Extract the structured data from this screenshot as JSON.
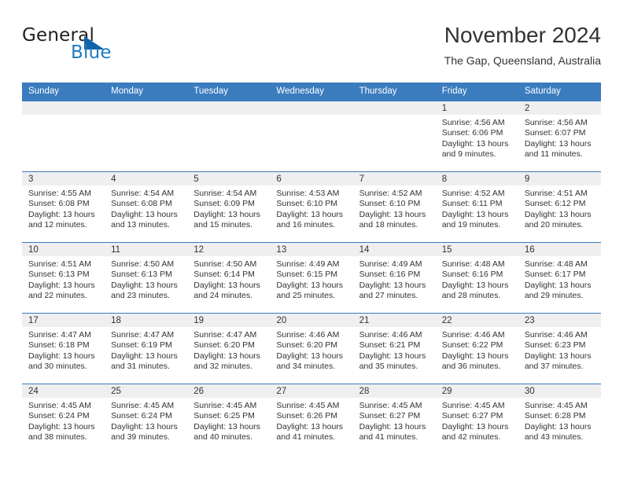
{
  "brand": {
    "name_part1": "General",
    "name_part2": "Blue",
    "accent_color": "#1f7bc1",
    "triangle_color": "#1064a8",
    "triangle_icon": "triangle-icon"
  },
  "header": {
    "title": "November 2024",
    "subtitle": "The Gap, Queensland, Australia"
  },
  "theme": {
    "header_row_bg": "#3a7cbe",
    "date_band_bg": "#efefef",
    "text_color": "#333333",
    "cell_border": "#3a7cbe"
  },
  "calendar": {
    "weekdays": [
      "Sunday",
      "Monday",
      "Tuesday",
      "Wednesday",
      "Thursday",
      "Friday",
      "Saturday"
    ],
    "labels": {
      "sunrise": "Sunrise:",
      "sunset": "Sunset:",
      "daylight": "Daylight:"
    },
    "weeks": [
      [
        {
          "date": "",
          "empty": true
        },
        {
          "date": "",
          "empty": true
        },
        {
          "date": "",
          "empty": true
        },
        {
          "date": "",
          "empty": true
        },
        {
          "date": "",
          "empty": true
        },
        {
          "date": "1",
          "sunrise": "Sunrise: 4:56 AM",
          "sunset": "Sunset: 6:06 PM",
          "daylight_1": "Daylight: 13 hours",
          "daylight_2": "and 9 minutes."
        },
        {
          "date": "2",
          "sunrise": "Sunrise: 4:56 AM",
          "sunset": "Sunset: 6:07 PM",
          "daylight_1": "Daylight: 13 hours",
          "daylight_2": "and 11 minutes."
        }
      ],
      [
        {
          "date": "3",
          "sunrise": "Sunrise: 4:55 AM",
          "sunset": "Sunset: 6:08 PM",
          "daylight_1": "Daylight: 13 hours",
          "daylight_2": "and 12 minutes."
        },
        {
          "date": "4",
          "sunrise": "Sunrise: 4:54 AM",
          "sunset": "Sunset: 6:08 PM",
          "daylight_1": "Daylight: 13 hours",
          "daylight_2": "and 13 minutes."
        },
        {
          "date": "5",
          "sunrise": "Sunrise: 4:54 AM",
          "sunset": "Sunset: 6:09 PM",
          "daylight_1": "Daylight: 13 hours",
          "daylight_2": "and 15 minutes."
        },
        {
          "date": "6",
          "sunrise": "Sunrise: 4:53 AM",
          "sunset": "Sunset: 6:10 PM",
          "daylight_1": "Daylight: 13 hours",
          "daylight_2": "and 16 minutes."
        },
        {
          "date": "7",
          "sunrise": "Sunrise: 4:52 AM",
          "sunset": "Sunset: 6:10 PM",
          "daylight_1": "Daylight: 13 hours",
          "daylight_2": "and 18 minutes."
        },
        {
          "date": "8",
          "sunrise": "Sunrise: 4:52 AM",
          "sunset": "Sunset: 6:11 PM",
          "daylight_1": "Daylight: 13 hours",
          "daylight_2": "and 19 minutes."
        },
        {
          "date": "9",
          "sunrise": "Sunrise: 4:51 AM",
          "sunset": "Sunset: 6:12 PM",
          "daylight_1": "Daylight: 13 hours",
          "daylight_2": "and 20 minutes."
        }
      ],
      [
        {
          "date": "10",
          "sunrise": "Sunrise: 4:51 AM",
          "sunset": "Sunset: 6:13 PM",
          "daylight_1": "Daylight: 13 hours",
          "daylight_2": "and 22 minutes."
        },
        {
          "date": "11",
          "sunrise": "Sunrise: 4:50 AM",
          "sunset": "Sunset: 6:13 PM",
          "daylight_1": "Daylight: 13 hours",
          "daylight_2": "and 23 minutes."
        },
        {
          "date": "12",
          "sunrise": "Sunrise: 4:50 AM",
          "sunset": "Sunset: 6:14 PM",
          "daylight_1": "Daylight: 13 hours",
          "daylight_2": "and 24 minutes."
        },
        {
          "date": "13",
          "sunrise": "Sunrise: 4:49 AM",
          "sunset": "Sunset: 6:15 PM",
          "daylight_1": "Daylight: 13 hours",
          "daylight_2": "and 25 minutes."
        },
        {
          "date": "14",
          "sunrise": "Sunrise: 4:49 AM",
          "sunset": "Sunset: 6:16 PM",
          "daylight_1": "Daylight: 13 hours",
          "daylight_2": "and 27 minutes."
        },
        {
          "date": "15",
          "sunrise": "Sunrise: 4:48 AM",
          "sunset": "Sunset: 6:16 PM",
          "daylight_1": "Daylight: 13 hours",
          "daylight_2": "and 28 minutes."
        },
        {
          "date": "16",
          "sunrise": "Sunrise: 4:48 AM",
          "sunset": "Sunset: 6:17 PM",
          "daylight_1": "Daylight: 13 hours",
          "daylight_2": "and 29 minutes."
        }
      ],
      [
        {
          "date": "17",
          "sunrise": "Sunrise: 4:47 AM",
          "sunset": "Sunset: 6:18 PM",
          "daylight_1": "Daylight: 13 hours",
          "daylight_2": "and 30 minutes."
        },
        {
          "date": "18",
          "sunrise": "Sunrise: 4:47 AM",
          "sunset": "Sunset: 6:19 PM",
          "daylight_1": "Daylight: 13 hours",
          "daylight_2": "and 31 minutes."
        },
        {
          "date": "19",
          "sunrise": "Sunrise: 4:47 AM",
          "sunset": "Sunset: 6:20 PM",
          "daylight_1": "Daylight: 13 hours",
          "daylight_2": "and 32 minutes."
        },
        {
          "date": "20",
          "sunrise": "Sunrise: 4:46 AM",
          "sunset": "Sunset: 6:20 PM",
          "daylight_1": "Daylight: 13 hours",
          "daylight_2": "and 34 minutes."
        },
        {
          "date": "21",
          "sunrise": "Sunrise: 4:46 AM",
          "sunset": "Sunset: 6:21 PM",
          "daylight_1": "Daylight: 13 hours",
          "daylight_2": "and 35 minutes."
        },
        {
          "date": "22",
          "sunrise": "Sunrise: 4:46 AM",
          "sunset": "Sunset: 6:22 PM",
          "daylight_1": "Daylight: 13 hours",
          "daylight_2": "and 36 minutes."
        },
        {
          "date": "23",
          "sunrise": "Sunrise: 4:46 AM",
          "sunset": "Sunset: 6:23 PM",
          "daylight_1": "Daylight: 13 hours",
          "daylight_2": "and 37 minutes."
        }
      ],
      [
        {
          "date": "24",
          "sunrise": "Sunrise: 4:45 AM",
          "sunset": "Sunset: 6:24 PM",
          "daylight_1": "Daylight: 13 hours",
          "daylight_2": "and 38 minutes."
        },
        {
          "date": "25",
          "sunrise": "Sunrise: 4:45 AM",
          "sunset": "Sunset: 6:24 PM",
          "daylight_1": "Daylight: 13 hours",
          "daylight_2": "and 39 minutes."
        },
        {
          "date": "26",
          "sunrise": "Sunrise: 4:45 AM",
          "sunset": "Sunset: 6:25 PM",
          "daylight_1": "Daylight: 13 hours",
          "daylight_2": "and 40 minutes."
        },
        {
          "date": "27",
          "sunrise": "Sunrise: 4:45 AM",
          "sunset": "Sunset: 6:26 PM",
          "daylight_1": "Daylight: 13 hours",
          "daylight_2": "and 41 minutes."
        },
        {
          "date": "28",
          "sunrise": "Sunrise: 4:45 AM",
          "sunset": "Sunset: 6:27 PM",
          "daylight_1": "Daylight: 13 hours",
          "daylight_2": "and 41 minutes."
        },
        {
          "date": "29",
          "sunrise": "Sunrise: 4:45 AM",
          "sunset": "Sunset: 6:27 PM",
          "daylight_1": "Daylight: 13 hours",
          "daylight_2": "and 42 minutes."
        },
        {
          "date": "30",
          "sunrise": "Sunrise: 4:45 AM",
          "sunset": "Sunset: 6:28 PM",
          "daylight_1": "Daylight: 13 hours",
          "daylight_2": "and 43 minutes."
        }
      ]
    ]
  }
}
